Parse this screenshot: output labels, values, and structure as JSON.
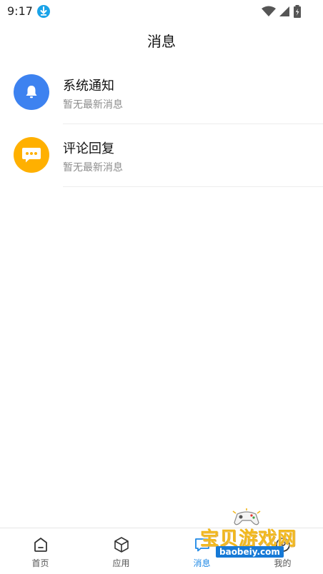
{
  "status_bar": {
    "time": "9:17"
  },
  "header": {
    "title": "消息"
  },
  "messages": [
    {
      "title": "系统通知",
      "subtitle": "暂无最新消息",
      "avatar_color": "#3d82f0",
      "icon": "bell-icon"
    },
    {
      "title": "评论回复",
      "subtitle": "暂无最新消息",
      "avatar_color": "#ffb000",
      "icon": "chat-bubble-icon"
    }
  ],
  "tabbar": {
    "items": [
      {
        "label": "首页",
        "icon": "home-icon",
        "active": false
      },
      {
        "label": "应用",
        "icon": "cube-icon",
        "active": false
      },
      {
        "label": "消息",
        "icon": "message-icon",
        "active": true
      },
      {
        "label": "我的",
        "icon": "profile-icon",
        "active": false
      }
    ],
    "active_color": "#1e88e5"
  },
  "watermark": {
    "text": "宝贝游戏网",
    "url": "baobeiy.com"
  }
}
